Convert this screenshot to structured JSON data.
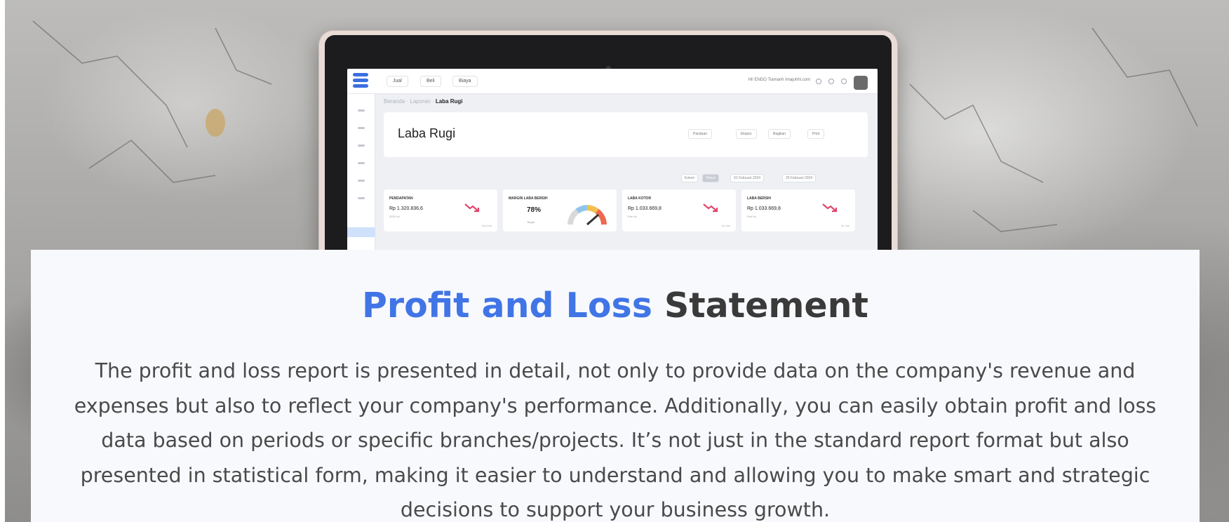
{
  "heading": {
    "accent": "Profit and Loss",
    "rest": "Statement"
  },
  "description": "The profit and loss report is presented in detail, not only to provide data on the company's revenue and expenses but also to reflect your company's performance. Additionally, you can easily obtain profit and loss data based on periods or specific branches/projects. It’s not just in the standard report format but also presented in statistical form, making it easier to understand and allowing you to make smart and strategic decisions to support your business growth.",
  "screen": {
    "tabs": [
      "Jual",
      "Beli",
      "Biaya"
    ],
    "user_email": "Hi! ENDO Tiamanh Imajuhhi.com",
    "breadcrumb": {
      "home": "Beranda",
      "section": "Laporan",
      "current": "Laba Rugi"
    },
    "page_title": "Laba Rugi",
    "header_buttons": [
      "Panduan",
      "Ekspor",
      "Bagikan",
      "Print"
    ],
    "filters": {
      "toggle_a": "Kolom",
      "toggle_b": "Tahun",
      "date_from": "01 Februari 2024",
      "date_to": "29 Februari 2024"
    },
    "cards": [
      {
        "label": "PENDAPATAN",
        "value": "Rp 1.320.836,6",
        "sub": "2023 Vs",
        "foot": "Jan-Feb",
        "trend": "down"
      },
      {
        "label": "MARGIN LABA BERSIH",
        "value": "78%",
        "sub": "Target",
        "foot": "",
        "trend": "gauge"
      },
      {
        "label": "LABA KOTOR",
        "value": "Rp 1.033.669,8",
        "sub": "Feb Vs",
        "foot": "Vs Jan",
        "trend": "down"
      },
      {
        "label": "LABA BERSIH",
        "value": "Rp 1.033.669,8",
        "sub": "Feb Vs",
        "foot": "Vs Jan",
        "trend": "down"
      }
    ],
    "colors": {
      "brand": "#3b6fe0",
      "trend_down": "#e0466a"
    }
  }
}
